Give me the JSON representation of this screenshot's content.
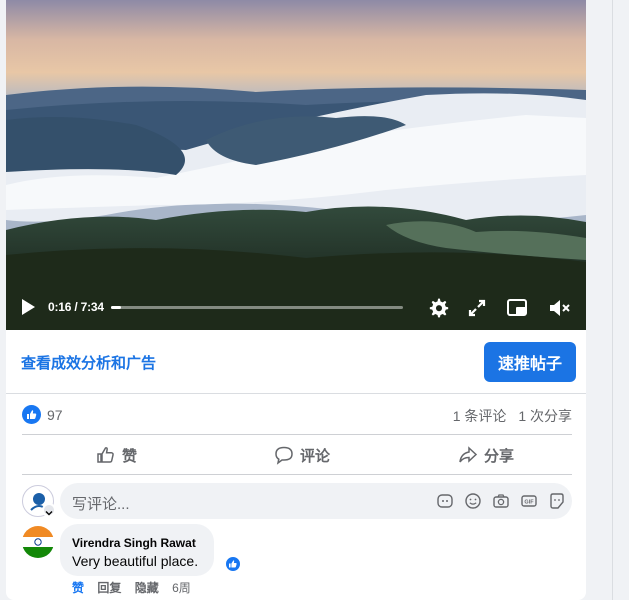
{
  "video": {
    "time": "0:16 / 7:34",
    "progress": 0.035
  },
  "promo": {
    "insights_label": "查看成效分析和广告",
    "boost_label": "速推帖子"
  },
  "stats": {
    "likes": "97",
    "comments": "1 条评论",
    "shares": "1 次分享"
  },
  "actions": {
    "like": "赞",
    "comment": "评论",
    "share": "分享"
  },
  "composer": {
    "placeholder": "写评论..."
  },
  "comment": {
    "author": "Virendra Singh Rawat",
    "text": "Very beautiful place.",
    "like_label": "赞",
    "reply_label": "回复",
    "hide_label": "隐藏",
    "age": "6周"
  },
  "colors": {
    "accent": "#1b74e4",
    "like_blue": "#1877f2",
    "muted": "#65676b"
  },
  "icons": [
    "play-icon",
    "settings-icon",
    "fullscreen-icon",
    "pip-icon",
    "mute-icon",
    "like-icon",
    "comment-icon",
    "share-icon",
    "sticker-icon",
    "emoji-icon",
    "camera-icon",
    "gif-icon",
    "avatar-sticker-icon"
  ]
}
